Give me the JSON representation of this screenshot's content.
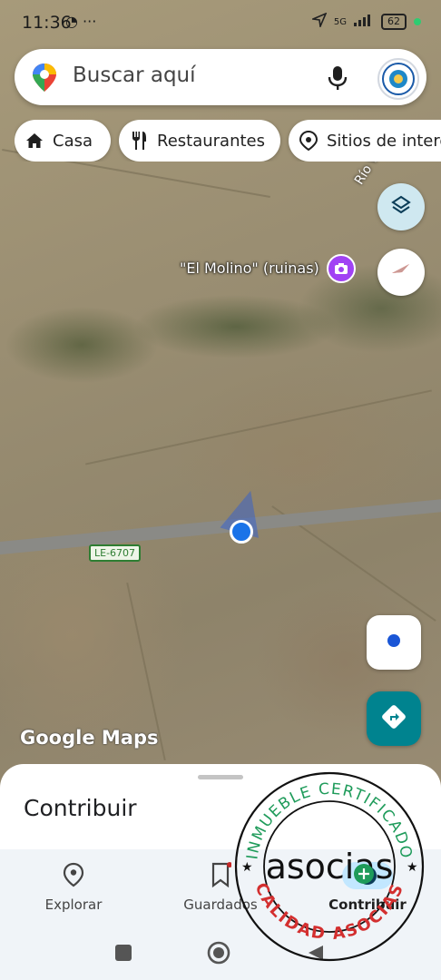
{
  "status_bar": {
    "time": "11:36",
    "left_icons": "◔ ···",
    "network": "5G",
    "battery": "62"
  },
  "search": {
    "placeholder": "Buscar aquí"
  },
  "chips": [
    {
      "label": "Casa",
      "icon": "home-icon"
    },
    {
      "label": "Restaurantes",
      "icon": "restaurant-icon"
    },
    {
      "label": "Sitios de interé",
      "icon": "camera-pin-icon"
    }
  ],
  "map": {
    "poi_label": "\"El Molino\" (ruinas)",
    "river_label": "Río Valo",
    "road_label": "LE-6707",
    "logo": "Google Maps"
  },
  "sheet": {
    "title": "Contribuir"
  },
  "bottom_nav": [
    {
      "label": "Explorar",
      "icon": "location-pin-icon"
    },
    {
      "label": "Guardados",
      "icon": "bookmark-icon"
    },
    {
      "label": "Contribuir",
      "icon": "add-circle-icon"
    }
  ],
  "stamp": {
    "top_text": "INMUEBLE CERTIFICADO",
    "bottom_text": "CALIDAD ASOCIAS",
    "brand": "asocias"
  },
  "colors": {
    "accent_blue": "#1a73e8",
    "teal": "#00838f",
    "poi_purple": "#a142f4",
    "stamp_green": "#1e9b5a",
    "stamp_red": "#d32f2f"
  }
}
